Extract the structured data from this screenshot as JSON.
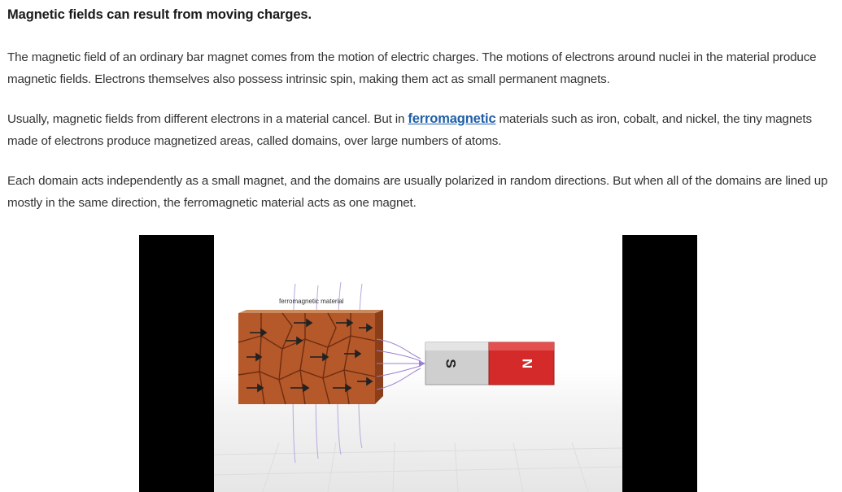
{
  "heading": "Magnetic fields can result from moving charges.",
  "paragraphs": {
    "p1": "The magnetic field of an ordinary bar magnet comes from the motion of electric charges. The motions of electrons around nuclei in the material produce magnetic fields. Electrons themselves also possess intrinsic spin, making them act as small permanent magnets.",
    "p2_before": "Usually, magnetic fields from different electrons in a material cancel. But in ",
    "p2_link": "ferromagnetic",
    "p2_after": " materials such as iron, cobalt, and nickel, the tiny magnets made of electrons produce magnetized areas, called domains, over large numbers of atoms.",
    "p3": "Each domain acts independently as a small magnet, and the domains are usually polarized in random directions. But when all of the domains are lined up mostly in the same direction, the ferromagnetic material acts as one magnet."
  },
  "video": {
    "material_label": "ferromagnetic material",
    "magnet_south": "S",
    "magnet_north": "N",
    "colors": {
      "material": "#b5582a",
      "magnet_red": "#d42a2a",
      "magnet_gray": "#cfcfcf",
      "field_lines": "#9b7fd0"
    }
  }
}
